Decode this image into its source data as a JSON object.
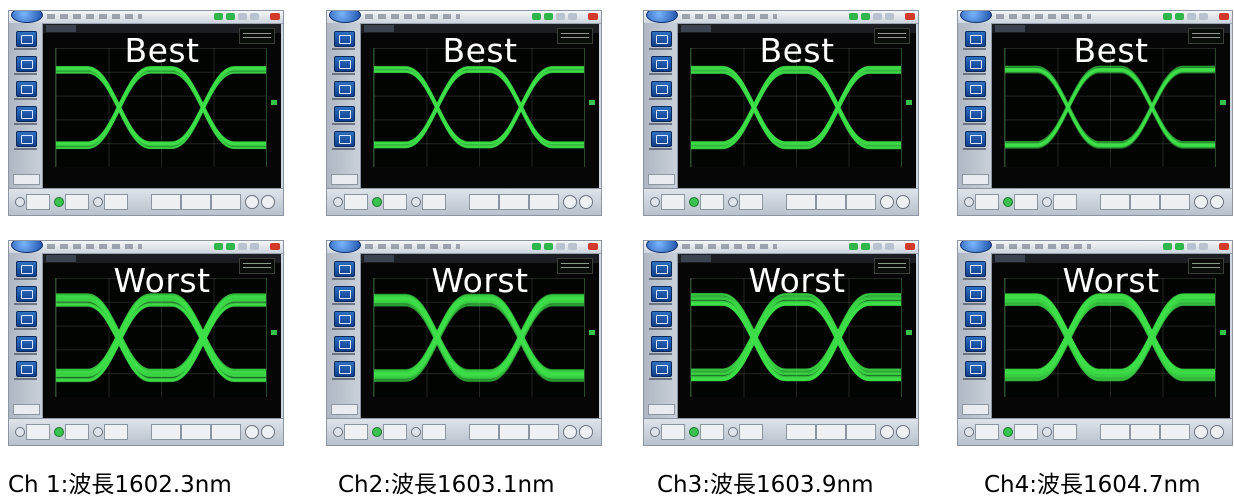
{
  "rows": [
    {
      "label": "Best"
    },
    {
      "label": "Worst"
    }
  ],
  "columns": [
    {
      "caption": "Ch 1:波長1602.3nm"
    },
    {
      "caption": "Ch2:波長1603.1nm"
    },
    {
      "caption": "Ch3:波長1603.9nm"
    },
    {
      "caption": "Ch4:波長1604.7nm"
    }
  ],
  "colors": {
    "trace": "#3fe04a",
    "screen_bg": "#020402",
    "label_text": "#ffffff"
  },
  "icons": {
    "window_close": "close-icon",
    "app_logo": "scope-logo-icon",
    "sidebar_buttons": [
      "measure-icon",
      "marker-icon",
      "histogram-icon",
      "scaling-icon",
      "overview-icon"
    ]
  }
}
